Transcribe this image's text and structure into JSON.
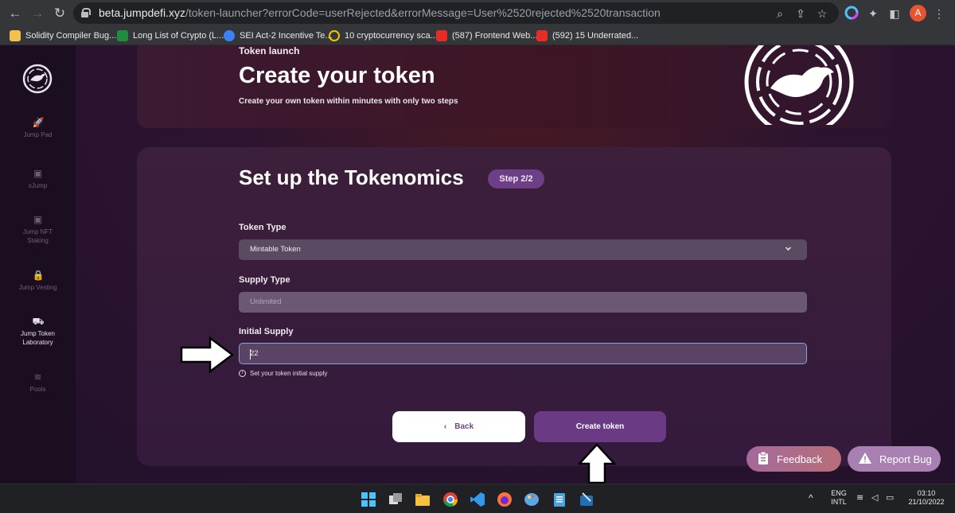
{
  "browser": {
    "url_host": "beta.jumpdefi.xyz",
    "url_path": "/token-launcher?errorCode=userRejected&errorMessage=User%2520rejected%2520transaction",
    "profile_initial": "A",
    "bookmarks": [
      {
        "label": "Solidity Compiler Bug...",
        "color": "#f2c14e"
      },
      {
        "label": "Long List of Crypto (L...",
        "color": "#1e8e3e"
      },
      {
        "label": "SEI Act-2 Incentive Te...",
        "color": "#3b82f6"
      },
      {
        "label": "10 cryptocurrency sca...",
        "color": "#f5c400"
      },
      {
        "label": "(587) Frontend Web...",
        "color": "#e52d27"
      },
      {
        "label": "(592) 15 Underrated...",
        "color": "#e52d27"
      }
    ]
  },
  "sidebar": {
    "items": [
      {
        "label": "Jump Pad",
        "icon": "rocket-icon"
      },
      {
        "label": "xJump",
        "icon": "wallet-icon"
      },
      {
        "label": "Jump NFT Staking",
        "icon": "wallet-icon"
      },
      {
        "label": "Jump Vesting",
        "icon": "lock-icon"
      },
      {
        "label": "Jump Token Laboratory",
        "icon": "tractor-icon"
      },
      {
        "label": "Pools",
        "icon": "waves-icon"
      }
    ]
  },
  "hero": {
    "kicker": "Token launch",
    "title": "Create your token",
    "subtitle": "Create your own token within minutes with only two steps"
  },
  "form": {
    "title": "Set up the Tokenomics",
    "step": "Step 2/2",
    "token_type_label": "Token Type",
    "token_type_value": "Mintable Token",
    "supply_type_label": "Supply Type",
    "supply_type_placeholder": "Unlimited",
    "initial_supply_label": "Initial Supply",
    "initial_supply_value": "22",
    "initial_supply_hint": "Set your token initial supply",
    "back_label": "Back",
    "create_label": "Create token"
  },
  "floating": {
    "feedback_label": "Feedback",
    "report_label": "Report Bug"
  },
  "taskbar": {
    "lang_top": "ENG",
    "lang_bottom": "INTL",
    "time": "03:10",
    "date": "21/10/2022"
  },
  "colors": {
    "accent": "#6a3a84",
    "page_bg": "#22102a",
    "sidebar_bg": "#1c0e21"
  }
}
